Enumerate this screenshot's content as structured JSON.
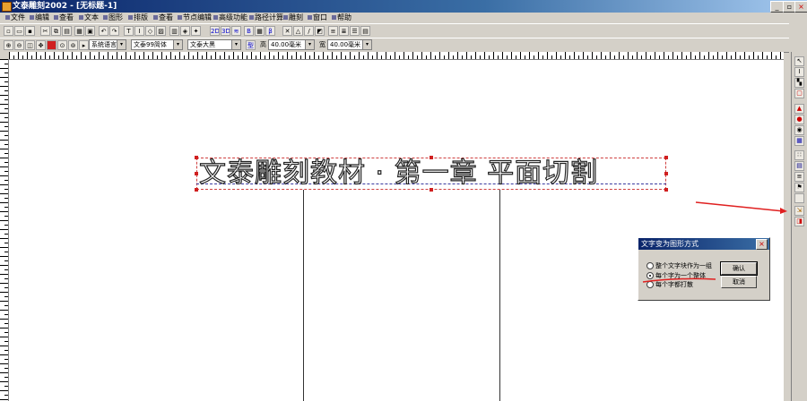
{
  "window": {
    "title": "文泰雕刻2002 - [无标题-1]",
    "controls": [
      "_",
      "▫",
      "×"
    ]
  },
  "menu": {
    "items": [
      "文件",
      "编辑",
      "查看",
      "文本",
      "图形",
      "排版",
      "查看",
      "节点编辑",
      "高级功能",
      "路径计算",
      "雕刻",
      "窗口",
      "帮助"
    ]
  },
  "toolbar_font": {
    "language": "系统语言",
    "font_family": "文泰99简体",
    "font_effect": "文泰大黑",
    "width_label": "高",
    "width_value": "40.00毫米",
    "height_label": "宽",
    "height_value": "40.00毫米"
  },
  "canvas": {
    "text": "文泰雕刻教材 · 第一章 平面切割"
  },
  "dialog": {
    "title": "文字变为图形方式",
    "options": [
      "整个文字块作为一组",
      "每个字为一个整体",
      "每个字都打散"
    ],
    "selected_index": 1,
    "ok_label": "确认",
    "cancel_label": "取消"
  },
  "colors": {
    "accent_red": "#d02020",
    "title_blue": "#0a246a"
  }
}
